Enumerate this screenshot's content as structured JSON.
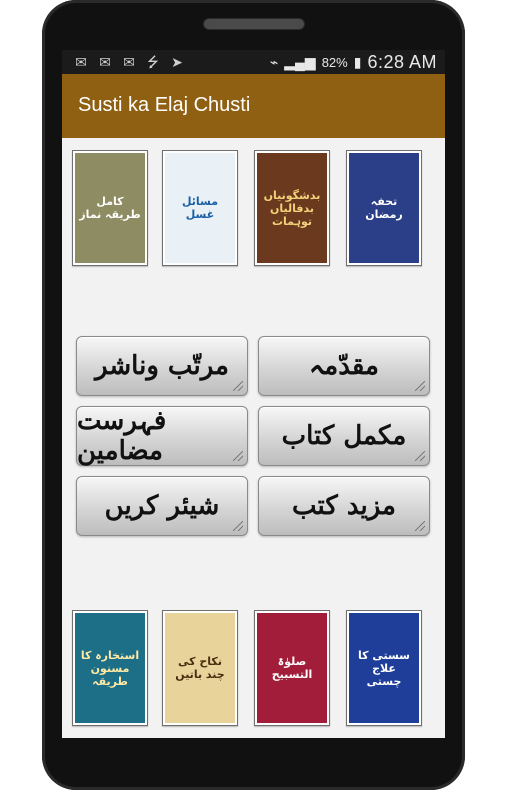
{
  "status_bar": {
    "icons_left": [
      "mail-icon",
      "mail-icon",
      "mail-icon",
      "usb-icon",
      "send-icon"
    ],
    "battery_percent": "82%",
    "time": "6:28 AM"
  },
  "app_bar": {
    "title": "Susti ka Elaj Chusti"
  },
  "books_top": [
    {
      "title": "تحفہ رمضان",
      "colors": {
        "bg": "#2a3f88",
        "fg": "#ffffff"
      }
    },
    {
      "title": "بدشگونیاں بدفالیاں توہمات",
      "colors": {
        "bg": "#6b3a1e",
        "fg": "#f3d27a"
      }
    },
    {
      "title": "مسائل غسل",
      "colors": {
        "bg": "#e9f1f7",
        "fg": "#1a5fa5"
      }
    },
    {
      "title": "کامل طریقہ نماز",
      "colors": {
        "bg": "#8d8c63",
        "fg": "#ffffff"
      }
    }
  ],
  "menu": {
    "muqaddama": "مقدّمہ",
    "murattib": "مرتّب وناشر",
    "mukammal_kitab": "مکمل کتاب",
    "fehrist": "فہرست مضامین",
    "mazeed_kutub": "مزید کتب",
    "share": "شیئر کریں"
  },
  "books_bottom": [
    {
      "title": "سستی کا علاج چستی",
      "colors": {
        "bg": "#1e3e9a",
        "fg": "#ffffff"
      }
    },
    {
      "title": "صلوٰۃ التسبیح",
      "colors": {
        "bg": "#a11d3a",
        "fg": "#ffffff"
      }
    },
    {
      "title": "نکاح کی چند باتیں",
      "colors": {
        "bg": "#e8d39a",
        "fg": "#4b2e12"
      }
    },
    {
      "title": "استخارہ کا مسنون طریقہ",
      "colors": {
        "bg": "#1d6f88",
        "fg": "#ffe9a6"
      }
    }
  ],
  "theme": {
    "accent": "#8f5f12"
  }
}
